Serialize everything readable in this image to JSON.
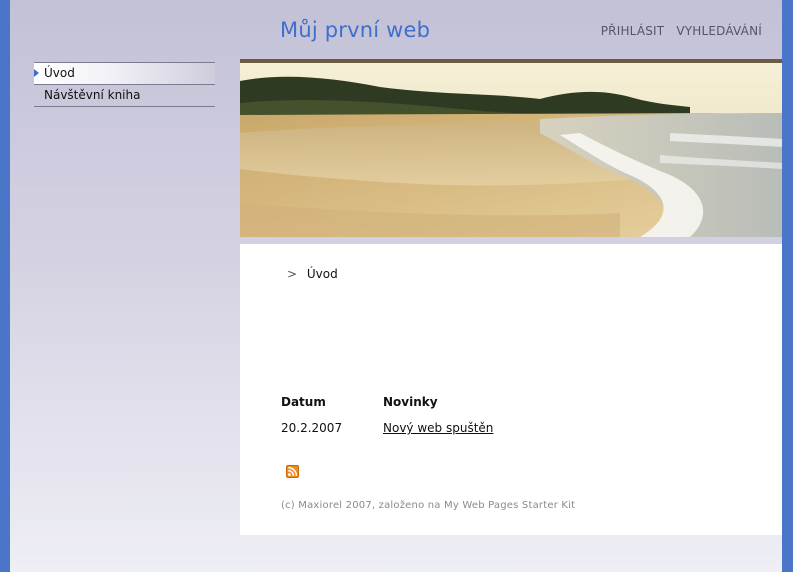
{
  "header": {
    "site_title": "Můj první web",
    "nav": [
      "PŘIHLÁSIT",
      "VYHLEDÁVÁNÍ"
    ]
  },
  "sidebar": {
    "items": [
      {
        "label": "Úvod",
        "active": true
      },
      {
        "label": "Návštěvní kniha",
        "active": false
      }
    ]
  },
  "breadcrumb": {
    "separator": ">",
    "current": "Úvod"
  },
  "news": {
    "headers": {
      "date": "Datum",
      "news": "Novinky"
    },
    "rows": [
      {
        "date": "20.2.2007",
        "title": "Nový web spuštěn"
      }
    ]
  },
  "footer": {
    "text": "(c) Maxiorel 2007, založeno na My Web Pages Starter Kit"
  },
  "colors": {
    "frame": "#4a75c9",
    "title": "#3f6fcb",
    "rss": "#f48a1f"
  },
  "icons": {
    "rss": "rss-feed-icon",
    "active_marker": "arrow-right-icon"
  }
}
